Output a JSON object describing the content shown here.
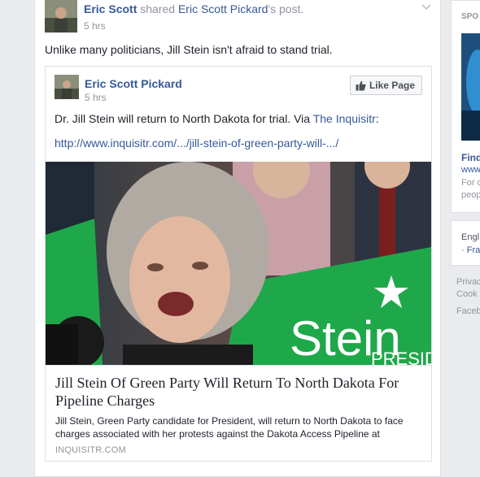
{
  "post": {
    "author": "Eric Scott",
    "shared_text": "shared",
    "shared_source": "Eric Scott Pickard",
    "shared_suffix": "'s post.",
    "time": "5 hrs",
    "message": "Unlike many politicians, Jill Stein isn't afraid to stand trial."
  },
  "shared_post": {
    "author": "Eric Scott Pickard",
    "time": "5 hrs",
    "like_button": "Like Page",
    "text": "Dr. Jill Stein will return to North Dakota for trial. Via",
    "via": "The Inquisitr",
    "via_suffix": ":",
    "link": "http://www.inquisitr.com/.../jill-stein-of-green-party-will-.../",
    "photo_sign_text": "Stein",
    "photo_sign_sub": "PRESIDEN"
  },
  "article": {
    "title": "Jill Stein Of Green Party Will Return To North Dakota For Pipeline Charges",
    "description": "Jill Stein, Green Party candidate for President, will return to North Dakota to face charges associated with her protests against the Dakota Access Pipeline at",
    "domain": "INQUISITR.COM"
  },
  "right_column": {
    "sponsored": "SPO",
    "ad_title": "Find",
    "ad_url": "www",
    "ad_line1": "For c",
    "ad_line2": "peop",
    "lang_current": "Engl",
    "lang_link": "· Fra",
    "footer_1": "Privac",
    "footer_2": "Cook",
    "footer_3": "Faceb"
  },
  "colors": {
    "link": "#365899",
    "meta": "#90949c",
    "sign_green": "#1fa84a"
  }
}
